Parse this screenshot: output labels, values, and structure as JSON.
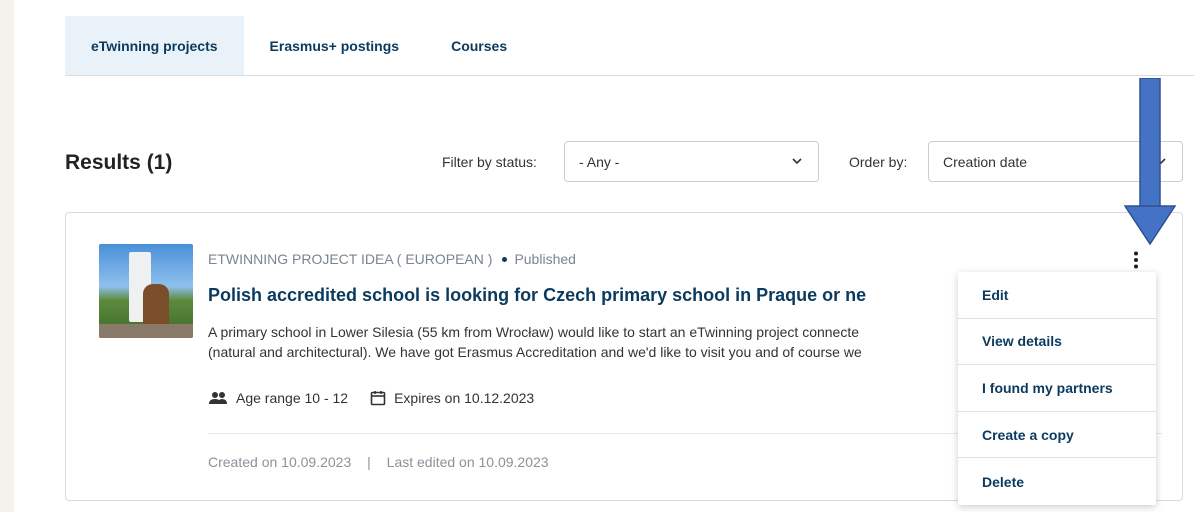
{
  "tabs": [
    {
      "label": "eTwinning projects",
      "active": true
    },
    {
      "label": "Erasmus+ postings",
      "active": false
    },
    {
      "label": "Courses",
      "active": false
    }
  ],
  "results": {
    "title": "Results (1)",
    "filter_label": "Filter by status:",
    "filter_value": "- Any -",
    "order_label": "Order by:",
    "order_value": "Creation date"
  },
  "card": {
    "type": "ETWINNING PROJECT IDEA ( EUROPEAN )",
    "status": "Published",
    "title": "Polish accredited school is looking for Czech primary school in Praque or ne",
    "description_line1": "A primary school in Lower Silesia (55 km from Wrocław) would like to start an eTwinning project connecte",
    "description_line2": "(natural and architectural). We have got Erasmus Accreditation and we'd like to visit you and of course we",
    "age_range": "Age range 10 - 12",
    "expires": "Expires on 10.12.2023",
    "created": "Created on 10.09.2023",
    "separator": "|",
    "last_edited": "Last edited on 10.09.2023"
  },
  "menu": {
    "items": [
      "Edit",
      "View details",
      "I found my partners",
      "Create a copy",
      "Delete"
    ]
  },
  "colors": {
    "primary": "#0b3a5e",
    "active_tab_bg": "#e9f2f8",
    "arrow": "#4472c4"
  }
}
